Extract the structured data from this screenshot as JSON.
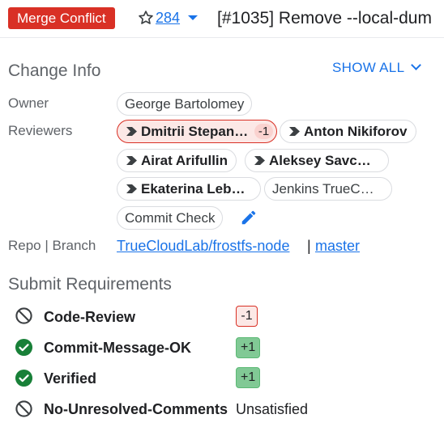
{
  "header": {
    "status": "Merge Conflict",
    "star_icon": "star-outline-icon",
    "star_count": "284",
    "title": "[#1035] Remove --local-dum"
  },
  "change_info": {
    "title": "Change Info",
    "show_all": "SHOW ALL",
    "owner_label": "Owner",
    "owner": "George Bartolomey",
    "reviewers_label": "Reviewers",
    "reviewers": [
      {
        "name": "Dmitrii Stepan…",
        "vote": "-1",
        "attention": true
      },
      {
        "name": "Anton Nikiforov",
        "attention": true
      },
      {
        "name": "Airat Arifullin",
        "attention": true
      },
      {
        "name": "Aleksey Savc…",
        "attention": true
      },
      {
        "name": "Ekaterina Leb…",
        "attention": true
      },
      {
        "name": "Jenkins TrueC…",
        "attention": false
      }
    ],
    "cc": "Commit Check",
    "edit_icon": "pencil-icon",
    "repo_label": "Repo | Branch",
    "repo": "TrueCloudLab/frostfs-node",
    "branch_separator": "|",
    "branch": "master"
  },
  "submit_requirements": {
    "title": "Submit Requirements",
    "items": [
      {
        "name": "Code-Review",
        "icon": "blocked-icon",
        "value": "-1"
      },
      {
        "name": "Commit-Message-OK",
        "icon": "check-circle-icon",
        "value": "+1"
      },
      {
        "name": "Verified",
        "icon": "check-circle-icon",
        "value": "+1"
      },
      {
        "name": "No-Unresolved-Comments",
        "icon": "blocked-icon",
        "value": "Unsatisfied"
      }
    ]
  },
  "colors": {
    "accent": "#1a73e8",
    "conflict": "#d93025",
    "approved": "#188038"
  }
}
